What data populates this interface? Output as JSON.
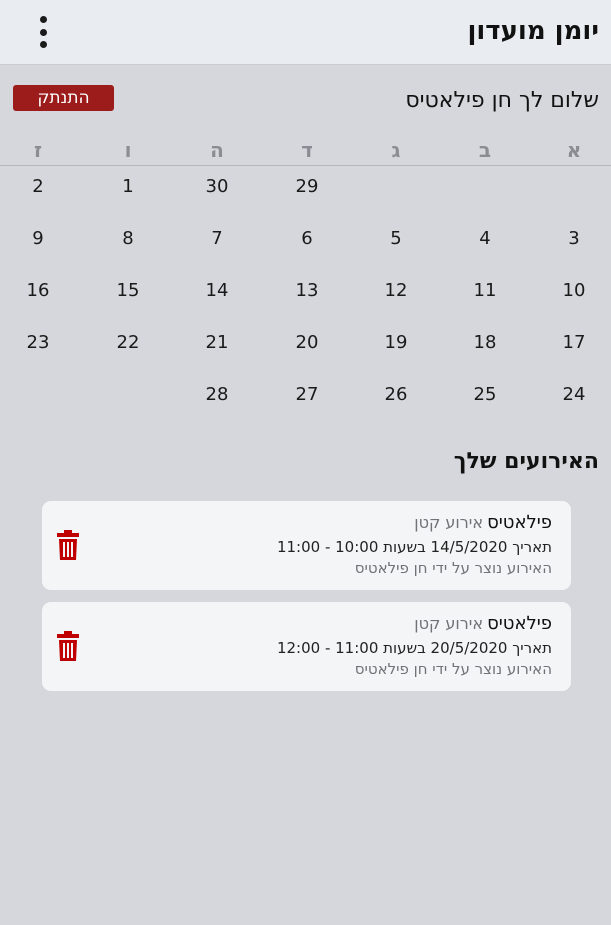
{
  "header": {
    "title": "יומן מועדון",
    "menu_icon": "more-vertical-icon"
  },
  "greeting": "שלום לך חן פילאטיס",
  "logout_label": "התנתק",
  "colors": {
    "logout_bg": "#9c1b1b",
    "trash": "#c00000",
    "page_bg": "#d5d7dc",
    "topbar_bg": "#e9ecf1",
    "card_bg": "#f4f5f6"
  },
  "calendar": {
    "weekdays": [
      "א",
      "ב",
      "ג",
      "ד",
      "ה",
      "ו",
      "ז"
    ],
    "weeks": [
      [
        "",
        "",
        "",
        "29",
        "30",
        "1",
        "2"
      ],
      [
        "3",
        "4",
        "5",
        "6",
        "7",
        "8",
        "9"
      ],
      [
        "10",
        "11",
        "12",
        "13",
        "14",
        "15",
        "16"
      ],
      [
        "17",
        "18",
        "19",
        "20",
        "21",
        "22",
        "23"
      ],
      [
        "24",
        "25",
        "26",
        "27",
        "28",
        "",
        ""
      ]
    ]
  },
  "events_title": "האירועים שלך",
  "events": [
    {
      "name": "פילאטיס",
      "type": "אירוע קטן",
      "details": "תאריך 14/5/2020 בשעות 10:00 - 11:00",
      "creator": "האירוע נוצר על ידי חן פילאטיס",
      "icon": "trash-icon"
    },
    {
      "name": "פילאטיס",
      "type": "אירוע קטן",
      "details": "תאריך 20/5/2020 בשעות 11:00 - 12:00",
      "creator": "האירוע נוצר על ידי חן פילאטיס",
      "icon": "trash-icon"
    }
  ]
}
